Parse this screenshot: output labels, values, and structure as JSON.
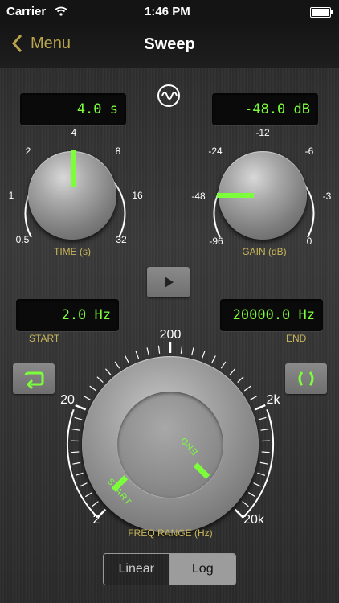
{
  "status": {
    "carrier": "Carrier",
    "time": "1:46 PM"
  },
  "nav": {
    "back_label": "Menu",
    "title": "Sweep"
  },
  "time": {
    "display": "4.0 s",
    "label": "TIME (s)",
    "ticks": [
      "0.5",
      "1",
      "2",
      "4",
      "8",
      "16",
      "32"
    ]
  },
  "gain": {
    "display": "-48.0 dB",
    "label": "GAIN (dB)",
    "ticks": [
      "-96",
      "-48",
      "-24",
      "-12",
      "-6",
      "-3",
      "0"
    ]
  },
  "freq": {
    "start_display": "2.0 Hz",
    "end_display": "20000.0 Hz",
    "start_label": "START",
    "end_label": "END",
    "range_label": "FREQ RANGE (Hz)",
    "ticks": [
      "2",
      "20",
      "200",
      "2k",
      "20k"
    ],
    "marker_start": "START",
    "marker_end": "END"
  },
  "scale": {
    "options": [
      "Linear",
      "Log"
    ],
    "selected": "Log"
  },
  "colors": {
    "accent": "#7cff3a",
    "label": "#c7b55a",
    "back": "#b7a44c"
  }
}
